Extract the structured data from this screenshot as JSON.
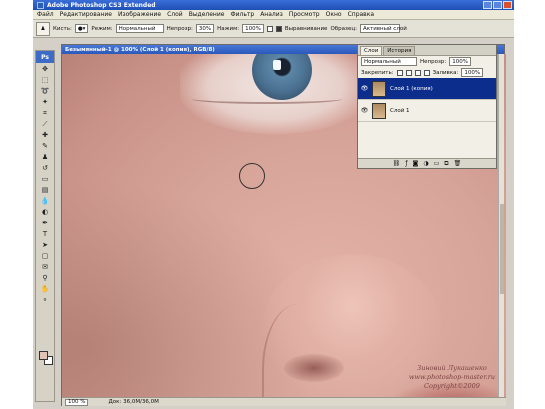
{
  "window": {
    "title": "Adobe Photoshop CS3 Extended"
  },
  "menu": [
    "Файл",
    "Редактирование",
    "Изображение",
    "Слой",
    "Выделение",
    "Фильтр",
    "Анализ",
    "Просмотр",
    "Окно",
    "Справка"
  ],
  "options": {
    "brush_label": "Кисть:",
    "mode_label": "Режим:",
    "mode_value": "Нормальный",
    "opacity_label": "Непрозр:",
    "opacity_value": "30%",
    "pressure_label": "Нажим:",
    "pressure_value": "100%",
    "align_label": "Выравнивание",
    "sample_label": "Образец:",
    "sample_value": "Активный слой"
  },
  "toolbox": {
    "header": "Ps"
  },
  "document": {
    "title": "Безымянный-1 @ 100% (Слой 1 (копия), RGB/8)",
    "zoom": "100 %",
    "doc_info": "Док: 36,0M/36,0M"
  },
  "watermark": {
    "line1": "Зиновий Лукашенко",
    "line2": "www.photoshop-master.ru",
    "line3": "Copyright©2009"
  },
  "layers_panel": {
    "tabs": [
      "Слои",
      "История"
    ],
    "blend_mode": "Нормальный",
    "opacity_label": "Непрозр:",
    "opacity_value": "100%",
    "lock_label": "Закрепить:",
    "fill_label": "Заливка:",
    "fill_value": "100%",
    "layers": [
      {
        "name": "Слой 1 (копия)",
        "selected": true
      },
      {
        "name": "Слой 1",
        "selected": false
      }
    ]
  }
}
